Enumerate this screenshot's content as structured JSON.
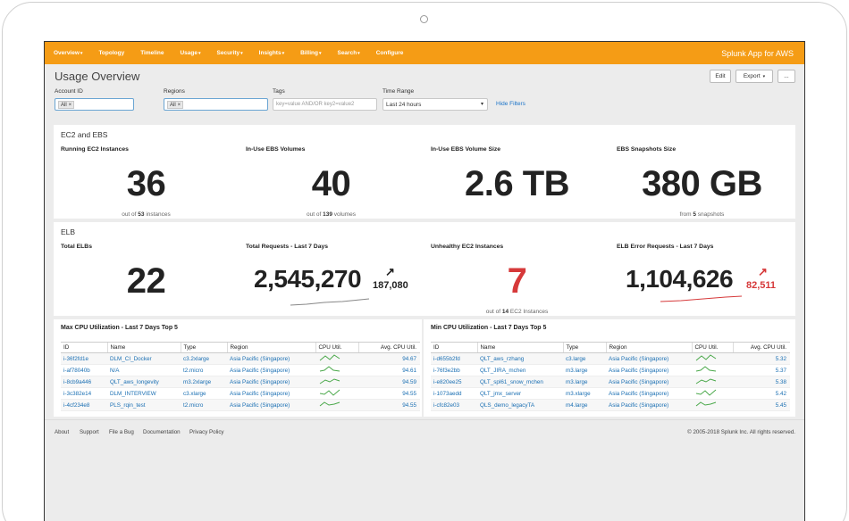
{
  "nav": {
    "items": [
      {
        "label": "Overview",
        "caret": true
      },
      {
        "label": "Topology",
        "caret": false
      },
      {
        "label": "Timeline",
        "caret": false
      },
      {
        "label": "Usage",
        "caret": true
      },
      {
        "label": "Security",
        "caret": true
      },
      {
        "label": "Insights",
        "caret": true
      },
      {
        "label": "Billing",
        "caret": true
      },
      {
        "label": "Search",
        "caret": true
      },
      {
        "label": "Configure",
        "caret": false
      }
    ],
    "app_title": "Splunk App for AWS",
    "accent": "#f59c15"
  },
  "header": {
    "title": "Usage Overview",
    "edit_label": "Edit",
    "export_label": "Export",
    "more_label": "..."
  },
  "filters": {
    "account": {
      "label": "Account ID",
      "token": "All"
    },
    "regions": {
      "label": "Regions",
      "token": "All"
    },
    "tags": {
      "label": "Tags",
      "placeholder": "key=value AND/OR key2=value2"
    },
    "time": {
      "label": "Time Range",
      "value": "Last 24 hours"
    },
    "hide_label": "Hide Filters"
  },
  "ec2": {
    "title": "EC2 and EBS",
    "stats": [
      {
        "label": "Running EC2 Instances",
        "value": "36",
        "sub_pre": "out of ",
        "sub_bold": "53",
        "sub_post": " instances"
      },
      {
        "label": "In-Use EBS Volumes",
        "value": "40",
        "sub_pre": "out of ",
        "sub_bold": "139",
        "sub_post": " volumes"
      },
      {
        "label": "In-Use EBS Volume Size",
        "value": "2.6 TB",
        "sub_pre": "",
        "sub_bold": "",
        "sub_post": ""
      },
      {
        "label": "EBS Snapshots Size",
        "value": "380 GB",
        "sub_pre": "from ",
        "sub_bold": "5",
        "sub_post": " snapshots"
      }
    ]
  },
  "elb": {
    "title": "ELB",
    "stats": [
      {
        "label": "Total ELBs",
        "value": "22"
      },
      {
        "label": "Total Requests - Last 7 Days",
        "value": "2,545,270",
        "trend": "187,080",
        "arrow": "↗"
      },
      {
        "label": "Unhealthy EC2 Instances",
        "value": "7",
        "sub_pre": "out of ",
        "sub_bold": "14",
        "sub_post": " EC2 Instances"
      },
      {
        "label": "ELB Error Requests - Last 7 Days",
        "value": "1,104,626",
        "trend": "82,511",
        "arrow": "↗"
      }
    ],
    "alert_color": "#d6393a"
  },
  "max_cpu": {
    "title": "Max CPU Utilization - Last 7 Days Top 5",
    "columns": [
      "ID",
      "Name",
      "Type",
      "Region",
      "CPU Util.",
      "Avg. CPU Util."
    ],
    "rows": [
      {
        "id": "i-36f2fd1e",
        "name": "DLM_CI_Docker",
        "type": "c3.2xlarge",
        "region": "Asia Pacific (Singapore)",
        "avg": "94.67"
      },
      {
        "id": "i-af78040b",
        "name": "N/A",
        "type": "t2.micro",
        "region": "Asia Pacific (Singapore)",
        "avg": "94.61"
      },
      {
        "id": "i-8cb9a446",
        "name": "QLT_aws_longevity",
        "type": "m3.2xlarge",
        "region": "Asia Pacific (Singapore)",
        "avg": "94.59"
      },
      {
        "id": "i-3c382e14",
        "name": "DLM_INTERVIEW",
        "type": "c3.xlarge",
        "region": "Asia Pacific (Singapore)",
        "avg": "94.55"
      },
      {
        "id": "i-4cf234e8",
        "name": "PLS_rqin_test",
        "type": "t2.micro",
        "region": "Asia Pacific (Singapore)",
        "avg": "94.55"
      }
    ]
  },
  "min_cpu": {
    "title": "Min CPU Utilization - Last 7 Days Top 5",
    "columns": [
      "ID",
      "Name",
      "Type",
      "Region",
      "CPU Util.",
      "Avg. CPU Util."
    ],
    "rows": [
      {
        "id": "i-d655b2fd",
        "name": "QLT_aws_rzhang",
        "type": "c3.large",
        "region": "Asia Pacific (Singapore)",
        "avg": "5.32"
      },
      {
        "id": "i-76f3e2bb",
        "name": "QLT_JIRA_mchen",
        "type": "m3.large",
        "region": "Asia Pacific (Singapore)",
        "avg": "5.37"
      },
      {
        "id": "i-e820ee25",
        "name": "QLT_spl61_snow_mchen",
        "type": "m3.large",
        "region": "Asia Pacific (Singapore)",
        "avg": "5.38"
      },
      {
        "id": "i-1073aedd",
        "name": "QLT_jmx_server",
        "type": "m3.xlarge",
        "region": "Asia Pacific (Singapore)",
        "avg": "5.42"
      },
      {
        "id": "i-cfc82e03",
        "name": "QLS_demo_legacyTA",
        "type": "m4.large",
        "region": "Asia Pacific (Singapore)",
        "avg": "5.45"
      }
    ]
  },
  "footer": {
    "links": [
      "About",
      "Support",
      "File a Bug",
      "Documentation",
      "Privacy Policy"
    ],
    "copyright": "© 2005-2018 Splunk Inc. All rights reserved."
  }
}
